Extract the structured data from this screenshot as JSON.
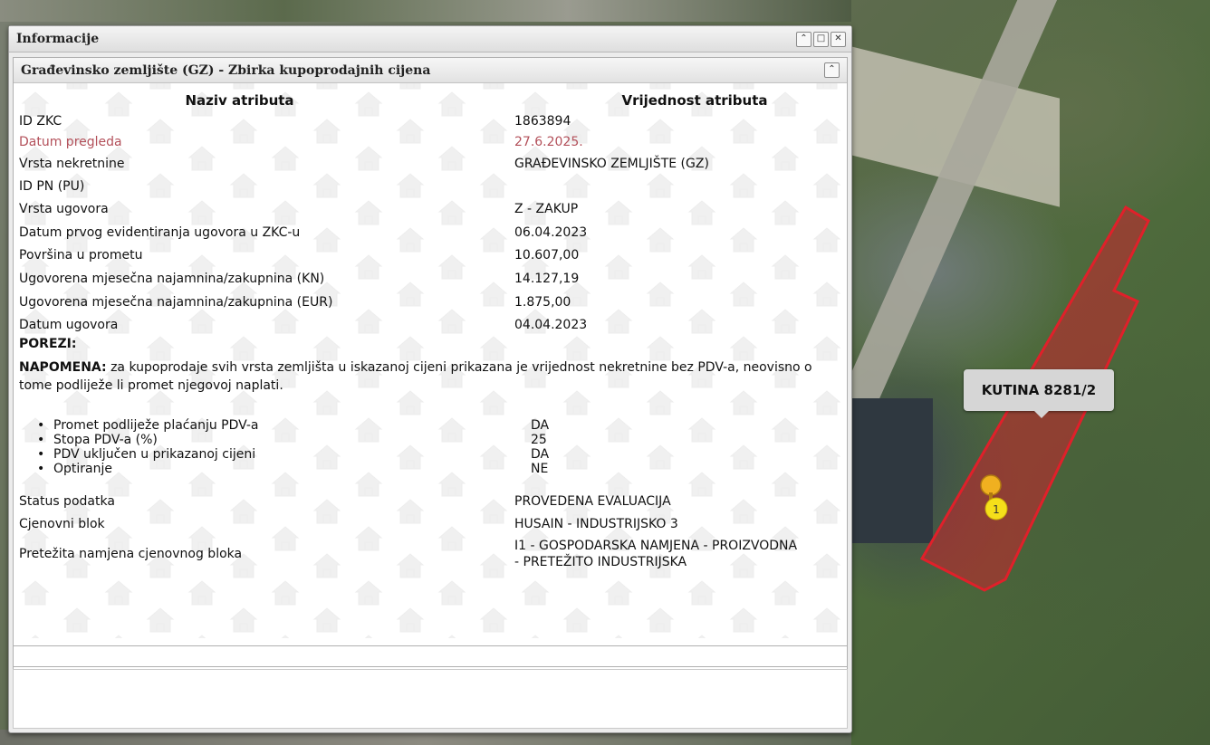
{
  "panel": {
    "title": "Informacije"
  },
  "section": {
    "title": "Građevinsko zemljište (GZ) - Zbirka kupoprodajnih cijena",
    "col_name": "Naziv atributa",
    "col_value": "Vrijednost atributa"
  },
  "rows": [
    {
      "label": "ID ZKC",
      "value": "1863894"
    },
    {
      "label": "Datum pregleda",
      "value": "27.6.2025."
    },
    {
      "label": "Vrsta nekretnine",
      "value": "GRAĐEVINSKO ZEMLJIŠTE (GZ)"
    },
    {
      "label": "ID PN (PU)",
      "value": ""
    },
    {
      "label": "Vrsta ugovora",
      "value": "Z - ZAKUP"
    },
    {
      "label": "Datum prvog evidentiranja ugovora u ZKC-u",
      "value": "06.04.2023"
    },
    {
      "label": "Površina u prometu",
      "value": "10.607,00"
    },
    {
      "label": "Ugovorena mjesečna najamnina/zakupnina (KN)",
      "value": "14.127,19"
    },
    {
      "label": "Ugovorena mjesečna najamnina/zakupnina (EUR)",
      "value": "1.875,00"
    },
    {
      "label": "Datum ugovora",
      "value": "04.04.2023"
    }
  ],
  "porezi": {
    "heading": "POREZI:",
    "note_label": "NAPOMENA:",
    "note_text": " za kupoprodaje svih vrsta zemljišta u iskazanoj cijeni prikazana je vrijednost nekretnine bez PDV-a, neovisno o tome podliježe li promet njegovoj naplati.",
    "items": [
      {
        "label": "Promet podliježe plaćanju PDV-a",
        "value": "DA"
      },
      {
        "label": "Stopa PDV-a (%)",
        "value": "25"
      },
      {
        "label": "PDV uključen u prikazanoj cijeni",
        "value": "DA"
      },
      {
        "label": "Optiranje",
        "value": "NE"
      }
    ]
  },
  "tail_rows": [
    {
      "label": "Status podatka",
      "value": "PROVEDENA EVALUACIJA"
    },
    {
      "label": "Cjenovni blok",
      "value": "HUSAIN - INDUSTRIJSKO 3"
    },
    {
      "label": "Pretežita namjena cjenovnog bloka",
      "value_line1": "I1 - GOSPODARSKA NAMJENA - PROIZVODNA",
      "value_line2": "- PRETEŽITO INDUSTRIJSKA"
    }
  ],
  "map": {
    "tooltip": "KUTINA 8281/2",
    "marker_number": "1",
    "parcel_color": "#c8232c",
    "marker_color": "#f2c51a"
  },
  "tools": [
    "collapse-icon",
    "maximize-icon",
    "close-icon"
  ]
}
